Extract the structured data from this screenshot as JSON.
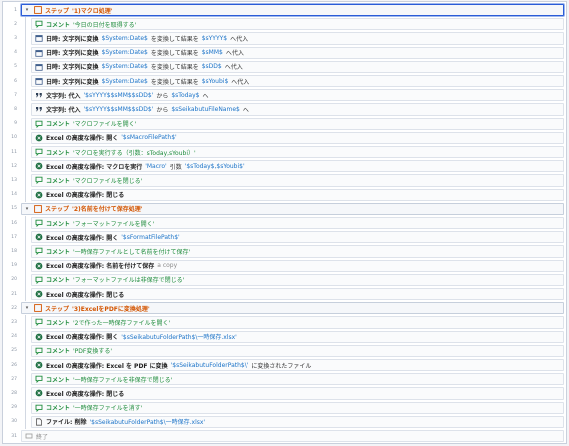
{
  "editor": {
    "rows": [
      {
        "no": "1",
        "type": "step",
        "icon": "step-icon",
        "level": 0,
        "parts": [
          {
            "t": "ステップ",
            "c": "kw-step"
          },
          {
            "t": "'1)マクロ処理'",
            "c": "kw-step"
          }
        ]
      },
      {
        "no": "2",
        "type": "comment",
        "icon": "comment-icon",
        "level": 1,
        "parts": [
          {
            "t": "コメント",
            "c": "kw-cmt"
          },
          {
            "t": "'今日の日付を取得する'",
            "c": "txt-cmt"
          }
        ]
      },
      {
        "no": "3",
        "type": "action",
        "icon": "calendar-icon",
        "level": 1,
        "parts": [
          {
            "t": "日時: 文字列に変換",
            "c": "kw"
          },
          {
            "t": "$System:Date$",
            "c": "val"
          },
          {
            "t": "を変換して結果を",
            "c": ""
          },
          {
            "t": "$sYYYY$",
            "c": "val"
          },
          {
            "t": "へ代入",
            "c": ""
          }
        ]
      },
      {
        "no": "4",
        "type": "action",
        "icon": "calendar-icon",
        "level": 1,
        "parts": [
          {
            "t": "日時: 文字列に変換",
            "c": "kw"
          },
          {
            "t": "$System:Date$",
            "c": "val"
          },
          {
            "t": "を変換して結果を",
            "c": ""
          },
          {
            "t": "$sMM$",
            "c": "val"
          },
          {
            "t": "へ代入",
            "c": ""
          }
        ]
      },
      {
        "no": "5",
        "type": "action",
        "icon": "calendar-icon",
        "level": 1,
        "parts": [
          {
            "t": "日時: 文字列に変換",
            "c": "kw"
          },
          {
            "t": "$System:Date$",
            "c": "val"
          },
          {
            "t": "を変換して結果を",
            "c": ""
          },
          {
            "t": "$sDD$",
            "c": "val"
          },
          {
            "t": "へ代入",
            "c": ""
          }
        ]
      },
      {
        "no": "6",
        "type": "action",
        "icon": "calendar-icon",
        "level": 1,
        "parts": [
          {
            "t": "日時: 文字列に変換",
            "c": "kw"
          },
          {
            "t": "$System:Date$",
            "c": "val"
          },
          {
            "t": "を変換して結果を",
            "c": ""
          },
          {
            "t": "$sYoubi$",
            "c": "val"
          },
          {
            "t": "へ代入",
            "c": ""
          }
        ]
      },
      {
        "no": "7",
        "type": "action",
        "icon": "quote-icon",
        "level": 1,
        "parts": [
          {
            "t": "文字列: 代入",
            "c": "kw"
          },
          {
            "t": "'$sYYYY$$sMM$$sDD$'",
            "c": "val"
          },
          {
            "t": "から",
            "c": ""
          },
          {
            "t": "$sToday$",
            "c": "val"
          },
          {
            "t": "へ",
            "c": ""
          }
        ]
      },
      {
        "no": "8",
        "type": "action",
        "icon": "quote-icon",
        "level": 1,
        "parts": [
          {
            "t": "文字列: 代入",
            "c": "kw"
          },
          {
            "t": "'$sYYYY$$sMM$$sDD$'",
            "c": "val"
          },
          {
            "t": "から",
            "c": ""
          },
          {
            "t": "$sSeikabutuFileName$",
            "c": "val"
          },
          {
            "t": "へ",
            "c": ""
          }
        ]
      },
      {
        "no": "9",
        "type": "comment",
        "icon": "comment-icon",
        "level": 1,
        "parts": [
          {
            "t": "コメント",
            "c": "kw-cmt"
          },
          {
            "t": "'マクロファイルを開く'",
            "c": "txt-cmt"
          }
        ]
      },
      {
        "no": "10",
        "type": "action",
        "icon": "excel-icon",
        "level": 1,
        "parts": [
          {
            "t": "Excel の高度な操作: 開く",
            "c": "kw"
          },
          {
            "t": "'$sMacroFilePath$'",
            "c": "val"
          }
        ]
      },
      {
        "no": "11",
        "type": "comment",
        "icon": "comment-icon",
        "level": 1,
        "parts": [
          {
            "t": "コメント",
            "c": "kw-cmt"
          },
          {
            "t": "'マクロを実行する（引数：sToday,sYoubi）'",
            "c": "txt-cmt"
          }
        ]
      },
      {
        "no": "12",
        "type": "action",
        "icon": "excel-icon",
        "level": 1,
        "parts": [
          {
            "t": "Excel の高度な操作: マクロを実行",
            "c": "kw"
          },
          {
            "t": "'Macro'",
            "c": "val"
          },
          {
            "t": "引数",
            "c": ""
          },
          {
            "t": "'$sToday$,$sYoubi$'",
            "c": "val"
          }
        ]
      },
      {
        "no": "13",
        "type": "comment",
        "icon": "comment-icon",
        "level": 1,
        "parts": [
          {
            "t": "コメント",
            "c": "kw-cmt"
          },
          {
            "t": "'マクロファイルを閉じる'",
            "c": "txt-cmt"
          }
        ]
      },
      {
        "no": "14",
        "type": "action",
        "icon": "excel-icon",
        "level": 1,
        "parts": [
          {
            "t": "Excel の高度な操作: 閉じる",
            "c": "kw"
          }
        ]
      },
      {
        "no": "15",
        "type": "step",
        "icon": "step-icon",
        "level": 0,
        "parts": [
          {
            "t": "ステップ",
            "c": "kw-step"
          },
          {
            "t": "'2)名前を付けて保存処理'",
            "c": "kw-step"
          }
        ]
      },
      {
        "no": "16",
        "type": "comment",
        "icon": "comment-icon",
        "level": 1,
        "parts": [
          {
            "t": "コメント",
            "c": "kw-cmt"
          },
          {
            "t": "'フォーマットファイルを開く'",
            "c": "txt-cmt"
          }
        ]
      },
      {
        "no": "17",
        "type": "action",
        "icon": "excel-icon",
        "level": 1,
        "parts": [
          {
            "t": "Excel の高度な操作: 開く",
            "c": "kw"
          },
          {
            "t": "'$sFormatFilePath$'",
            "c": "val"
          }
        ]
      },
      {
        "no": "18",
        "type": "comment",
        "icon": "comment-icon",
        "level": 1,
        "parts": [
          {
            "t": "コメント",
            "c": "kw-cmt"
          },
          {
            "t": "'一時保存ファイルとして名前を付けて保存'",
            "c": "txt-cmt"
          }
        ]
      },
      {
        "no": "19",
        "type": "action",
        "icon": "excel-icon",
        "level": 1,
        "parts": [
          {
            "t": "Excel の高度な操作: 名前を付けて保存",
            "c": "kw"
          },
          {
            "t": "a copy",
            "c": "dim"
          }
        ]
      },
      {
        "no": "20",
        "type": "comment",
        "icon": "comment-icon",
        "level": 1,
        "parts": [
          {
            "t": "コメント",
            "c": "kw-cmt"
          },
          {
            "t": "'フォーマットファイルは非保存で閉じる'",
            "c": "txt-cmt"
          }
        ]
      },
      {
        "no": "21",
        "type": "action",
        "icon": "excel-icon",
        "level": 1,
        "parts": [
          {
            "t": "Excel の高度な操作: 閉じる",
            "c": "kw"
          }
        ]
      },
      {
        "no": "22",
        "type": "step",
        "icon": "step-icon",
        "level": 0,
        "parts": [
          {
            "t": "ステップ",
            "c": "kw-step"
          },
          {
            "t": "'3)ExcelをPDFに変換処理'",
            "c": "kw-step"
          }
        ]
      },
      {
        "no": "23",
        "type": "comment",
        "icon": "comment-icon",
        "level": 1,
        "parts": [
          {
            "t": "コメント",
            "c": "kw-cmt"
          },
          {
            "t": "'2で作った一時保存ファイルを開く'",
            "c": "txt-cmt"
          }
        ]
      },
      {
        "no": "24",
        "type": "action",
        "icon": "excel-icon",
        "level": 1,
        "parts": [
          {
            "t": "Excel の高度な操作: 開く",
            "c": "kw"
          },
          {
            "t": "'$sSeikabutuFolderPath$\\一時保存.xlsx'",
            "c": "val"
          }
        ]
      },
      {
        "no": "25",
        "type": "comment",
        "icon": "comment-icon",
        "level": 1,
        "parts": [
          {
            "t": "コメント",
            "c": "kw-cmt"
          },
          {
            "t": "'PDF変換する'",
            "c": "txt-cmt"
          }
        ]
      },
      {
        "no": "26",
        "type": "action",
        "icon": "excel-icon",
        "level": 1,
        "parts": [
          {
            "t": "Excel の高度な操作: Excel を PDF に変換",
            "c": "kw"
          },
          {
            "t": "'$sSeikabutuFolderPath$\\'",
            "c": "val"
          },
          {
            "t": "に変換されたファイル",
            "c": ""
          }
        ]
      },
      {
        "no": "27",
        "type": "comment",
        "icon": "comment-icon",
        "level": 1,
        "parts": [
          {
            "t": "コメント",
            "c": "kw-cmt"
          },
          {
            "t": "'一時保存ファイルを非保存で閉じる'",
            "c": "txt-cmt"
          }
        ]
      },
      {
        "no": "28",
        "type": "action",
        "icon": "excel-icon",
        "level": 1,
        "parts": [
          {
            "t": "Excel の高度な操作: 閉じる",
            "c": "kw"
          }
        ]
      },
      {
        "no": "29",
        "type": "comment",
        "icon": "comment-icon",
        "level": 1,
        "parts": [
          {
            "t": "コメント",
            "c": "kw-cmt"
          },
          {
            "t": "'一時保存ファイルを消す'",
            "c": "txt-cmt"
          }
        ]
      },
      {
        "no": "30",
        "type": "action",
        "icon": "file-icon",
        "level": 1,
        "parts": [
          {
            "t": "ファイル: 削除",
            "c": "kw"
          },
          {
            "t": "'$sSeikabutuFolderPath$\\一時保存.xlsx'",
            "c": "val"
          }
        ]
      },
      {
        "no": "31",
        "type": "end",
        "icon": "end-icon",
        "level": 0,
        "parts": [
          {
            "t": "終了",
            "c": "dim"
          }
        ]
      }
    ]
  },
  "colors": {
    "step": "#d35400",
    "comment": "#1e8c3c",
    "value": "#1b73c8",
    "selection": "#2a5bd7",
    "excel": "#1d6f42"
  }
}
